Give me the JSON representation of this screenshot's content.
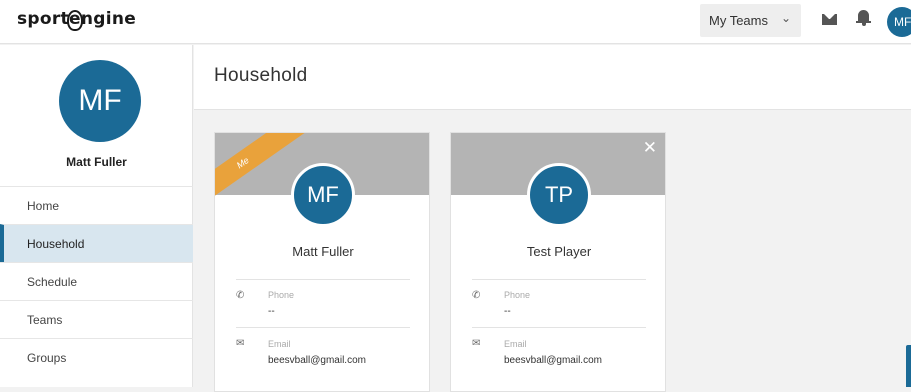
{
  "header": {
    "logo_left": "sport",
    "logo_e": "e",
    "logo_right": "ngine",
    "my_teams_label": "My Teams",
    "avatar_initials": "MF"
  },
  "sidebar": {
    "avatar_initials": "MF",
    "user_name": "Matt Fuller",
    "items": [
      {
        "label": "Home"
      },
      {
        "label": "Household"
      },
      {
        "label": "Schedule"
      },
      {
        "label": "Teams"
      },
      {
        "label": "Groups"
      }
    ],
    "active_item": "Household"
  },
  "page": {
    "title": "Household"
  },
  "members": [
    {
      "initials": "MF",
      "name": "Matt Fuller",
      "badge": "Me",
      "phone_label": "Phone",
      "phone_value": "--",
      "email_label": "Email",
      "email_value": "beesvball@gmail.com"
    },
    {
      "initials": "TP",
      "name": "Test Player",
      "phone_label": "Phone",
      "phone_value": "--",
      "email_label": "Email",
      "email_value": "beesvball@gmail.com"
    }
  ],
  "colors": {
    "brand_blue": "#1b6a96",
    "ribbon_orange": "#e9a23b",
    "band_gray": "#b4b4b4",
    "active_nav_bg": "#d8e6ef"
  }
}
